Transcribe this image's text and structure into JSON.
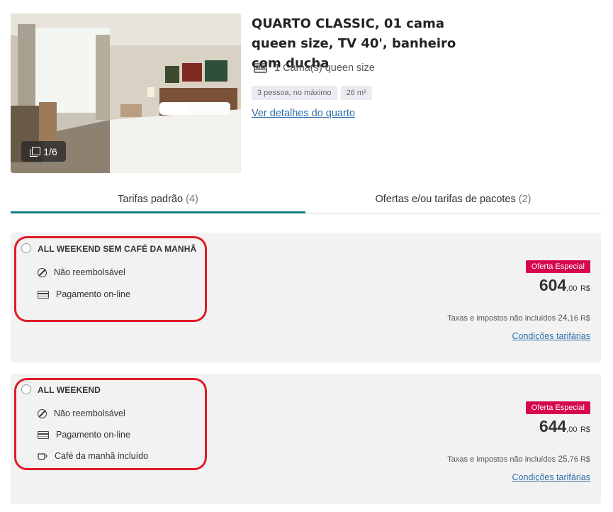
{
  "room": {
    "title": "QUARTO CLASSIC, 01 cama queen size, TV 40', banheiro com ducha",
    "photo_counter": "1/6",
    "bed": "1 Cama(s) queen size",
    "chips": [
      "3 pessoa, no máximo",
      "26 m²"
    ],
    "details_link": "Ver detalhes do quarto",
    "bed_icon": "bed-icon",
    "gallery_icon": "gallery-icon"
  },
  "tabs": [
    {
      "label": "Tarifas padrão",
      "count": "(4)",
      "active": true
    },
    {
      "label": "Ofertas e/ou tarifas de pacotes",
      "count": "(2)",
      "active": false
    }
  ],
  "rates": [
    {
      "name": "ALL WEEKEND SEM CAFÉ DA MANHÃ",
      "features": [
        {
          "icon": "no-refund-icon",
          "label": "Não reembolsável"
        },
        {
          "icon": "credit-card-icon",
          "label": "Pagamento on-line"
        }
      ],
      "badge": "Oferta Especial",
      "price_main": "604",
      "price_cents": ",00",
      "currency": "R$",
      "taxes_label": "Taxas e impostos não incluídos",
      "taxes_int": "24",
      "taxes_dec": ",16",
      "taxes_currency": "R$",
      "conditions": "Condições tarifárias"
    },
    {
      "name": "ALL WEEKEND",
      "features": [
        {
          "icon": "no-refund-icon",
          "label": "Não reembolsável"
        },
        {
          "icon": "credit-card-icon",
          "label": "Pagamento on-line"
        },
        {
          "icon": "coffee-cup-icon",
          "label": "Café da manhã incluído"
        }
      ],
      "badge": "Oferta Especial",
      "price_main": "644",
      "price_cents": ",00",
      "currency": "R$",
      "taxes_label": "Taxas e impostos não incluídos",
      "taxes_int": "25",
      "taxes_dec": ",76",
      "taxes_currency": "R$",
      "conditions": "Condições tarifárias"
    }
  ],
  "colors": {
    "accent_tab": "#157b84",
    "badge": "#d6074f",
    "link": "#2e6ea8",
    "highlight": "#e11a26",
    "card_bg": "#f2f2f2"
  }
}
